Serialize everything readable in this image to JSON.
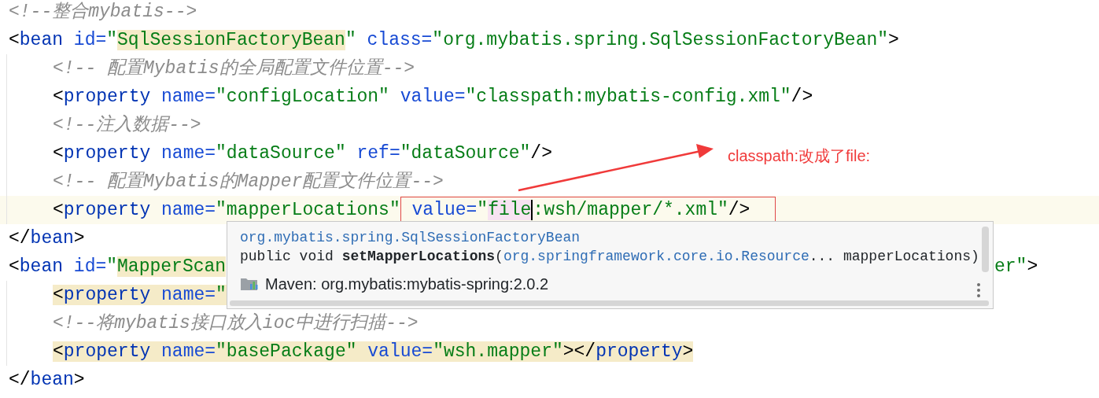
{
  "editor": {
    "lines": [
      {
        "current": false,
        "tokens": [
          {
            "text": "<!--整合mybatis-->",
            "kind": "comment",
            "highlighted": false
          }
        ]
      },
      {
        "current": false,
        "tokens": [
          {
            "text": "<",
            "kind": "punct",
            "highlighted": false
          },
          {
            "text": "bean",
            "kind": "tag",
            "highlighted": false
          },
          {
            "text": " id=",
            "kind": "attr",
            "highlighted": false
          },
          {
            "text": "\"",
            "kind": "string",
            "highlighted": false
          },
          {
            "text": "SqlSessionFactoryBean",
            "kind": "string",
            "highlighted": true
          },
          {
            "text": "\"",
            "kind": "string",
            "highlighted": false
          },
          {
            "text": " class=",
            "kind": "attr",
            "highlighted": false
          },
          {
            "text": "\"org.mybatis.spring.SqlSessionFactoryBean\"",
            "kind": "string",
            "highlighted": false
          },
          {
            "text": ">",
            "kind": "punct",
            "highlighted": false
          }
        ],
        "children": [
          {
            "current": false,
            "tokens": [
              {
                "text": "<!-- 配置Mybatis的全局配置文件位置-->",
                "kind": "comment",
                "highlighted": false
              }
            ]
          },
          {
            "current": false,
            "tokens": [
              {
                "text": "<",
                "kind": "punct",
                "highlighted": false
              },
              {
                "text": "property",
                "kind": "tag",
                "highlighted": false
              },
              {
                "text": " name=",
                "kind": "attr",
                "highlighted": false
              },
              {
                "text": "\"configLocation\"",
                "kind": "string",
                "highlighted": false
              },
              {
                "text": " value=",
                "kind": "attr",
                "highlighted": false
              },
              {
                "text": "\"classpath:mybatis-config.xml\"",
                "kind": "string",
                "highlighted": false
              },
              {
                "text": "/>",
                "kind": "punct",
                "highlighted": false
              }
            ]
          },
          {
            "current": false,
            "tokens": [
              {
                "text": "<!--注入数据-->",
                "kind": "comment",
                "highlighted": false
              }
            ]
          },
          {
            "current": false,
            "tokens": [
              {
                "text": "<",
                "kind": "punct",
                "highlighted": false
              },
              {
                "text": "property",
                "kind": "tag",
                "highlighted": false
              },
              {
                "text": " name=",
                "kind": "attr",
                "highlighted": false
              },
              {
                "text": "\"dataSource\"",
                "kind": "string",
                "highlighted": false
              },
              {
                "text": " ref=",
                "kind": "attr",
                "highlighted": false
              },
              {
                "text": "\"dataSource\"",
                "kind": "string",
                "highlighted": false
              },
              {
                "text": "/>",
                "kind": "punct",
                "highlighted": false
              }
            ]
          },
          {
            "current": false,
            "tokens": [
              {
                "text": "<!-- 配置Mybatis的Mapper配置文件位置-->",
                "kind": "comment",
                "highlighted": false
              }
            ]
          },
          {
            "current": true,
            "tokens": [
              {
                "text": "<",
                "kind": "punct",
                "highlighted": false
              },
              {
                "text": "property",
                "kind": "tag",
                "highlighted": false
              },
              {
                "text": " name=",
                "kind": "attr",
                "highlighted": false
              },
              {
                "text": "\"mapperLocations\"",
                "kind": "string",
                "highlighted": false
              }
            ],
            "marked_tokens": [
              {
                "text": " value=",
                "kind": "attr",
                "highlighted": false
              },
              {
                "text": "\"",
                "kind": "string",
                "highlighted": false
              },
              {
                "text": "file",
                "kind": "match",
                "highlighted": false
              },
              {
                "kind": "caret"
              },
              {
                "text": ":wsh/mapper/*.xml\"",
                "kind": "string",
                "highlighted": false
              },
              {
                "text": "/>",
                "kind": "punct",
                "highlighted": false
              }
            ]
          }
        ]
      },
      {
        "current": false,
        "tokens": [
          {
            "text": "</",
            "kind": "punct",
            "highlighted": false
          },
          {
            "text": "bean",
            "kind": "tag",
            "highlighted": false
          },
          {
            "text": ">",
            "kind": "punct",
            "highlighted": false
          }
        ]
      },
      {
        "current": false,
        "tokens": [
          {
            "text": "<",
            "kind": "punct",
            "highlighted": false
          },
          {
            "text": "bean",
            "kind": "tag",
            "highlighted": false
          },
          {
            "text": " id=",
            "kind": "attr",
            "highlighted": false
          },
          {
            "text": "\"",
            "kind": "string",
            "highlighted": false
          },
          {
            "text": "MapperScan",
            "kind": "string",
            "highlighted": true
          }
        ],
        "tail_tokens": [
          {
            "text": "er\"",
            "kind": "string",
            "highlighted": false
          },
          {
            "text": ">",
            "kind": "punct",
            "highlighted": false
          }
        ],
        "children": [
          {
            "current": false,
            "tokens": [
              {
                "text": "<",
                "kind": "punct",
                "highlighted": true
              },
              {
                "text": "property",
                "kind": "tag",
                "highlighted": true
              },
              {
                "text": " name=",
                "kind": "attr",
                "highlighted": true
              },
              {
                "text": "\"",
                "kind": "string",
                "highlighted": true
              }
            ]
          },
          {
            "current": false,
            "tokens": [
              {
                "text": "<!--将mybatis接口放入ioc中进行扫描-->",
                "kind": "comment",
                "highlighted": false
              }
            ]
          },
          {
            "current": false,
            "tokens": [
              {
                "text": "<",
                "kind": "punct",
                "highlighted": true
              },
              {
                "text": "property",
                "kind": "tag",
                "highlighted": true
              },
              {
                "text": " name=",
                "kind": "attr",
                "highlighted": true
              },
              {
                "text": "\"basePackage\"",
                "kind": "string",
                "highlighted": true
              },
              {
                "text": " value=",
                "kind": "attr",
                "highlighted": true
              },
              {
                "text": "\"wsh.mapper\"",
                "kind": "string",
                "highlighted": true
              },
              {
                "text": "></",
                "kind": "punct",
                "highlighted": true
              },
              {
                "text": "property",
                "kind": "tag",
                "highlighted": true
              },
              {
                "text": ">",
                "kind": "punct",
                "highlighted": true
              }
            ]
          }
        ]
      },
      {
        "current": false,
        "tokens": [
          {
            "text": "</",
            "kind": "punct",
            "highlighted": false
          },
          {
            "text": "bean",
            "kind": "tag",
            "highlighted": false
          },
          {
            "text": ">",
            "kind": "punct",
            "highlighted": false
          }
        ]
      }
    ]
  },
  "popup": {
    "class_name": "org.mybatis.spring.SqlSessionFactoryBean",
    "signature": [
      {
        "text": "public void ",
        "kind": "plain"
      },
      {
        "text": "setMapperLocations",
        "kind": "method"
      },
      {
        "text": "(",
        "kind": "plain"
      },
      {
        "text": "org.springframework.core.io.Resource",
        "kind": "type"
      },
      {
        "text": "... mapperLocations)",
        "kind": "plain"
      }
    ],
    "source": "Maven: org.mybatis:mybatis-spring:2.0.2"
  },
  "annotation": {
    "text": "classpath:改成了file:"
  }
}
